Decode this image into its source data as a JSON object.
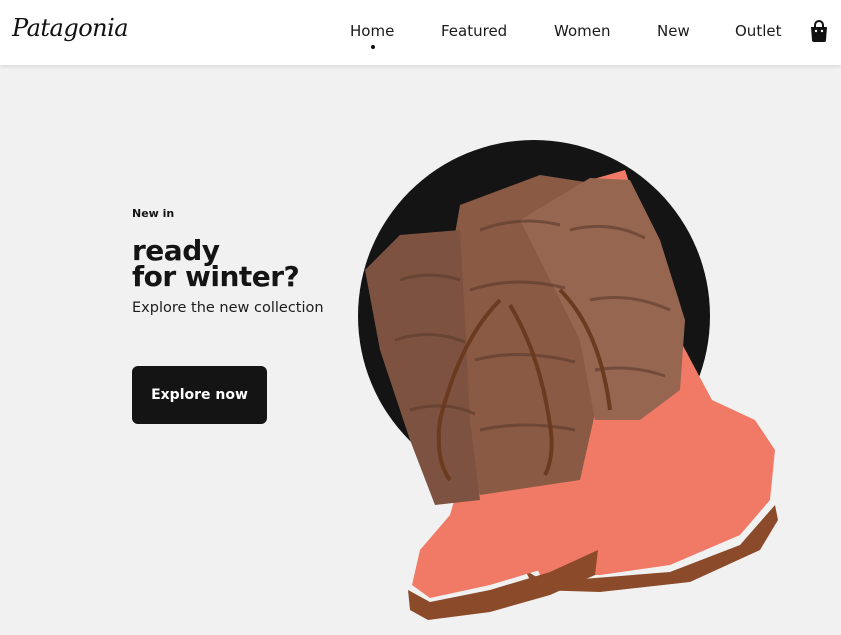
{
  "brand": {
    "name": "Patagonia"
  },
  "nav": {
    "items": [
      {
        "label": "Home",
        "active": true
      },
      {
        "label": "Featured"
      },
      {
        "label": "Women"
      },
      {
        "label": "New"
      },
      {
        "label": "Outlet"
      }
    ],
    "cart_icon": "shopping-bag-icon"
  },
  "hero": {
    "eyebrow": "New in",
    "headline_line1": "ready",
    "headline_line2": "for winter?",
    "subtitle": "Explore the new collection",
    "cta_label": "Explore now",
    "image": "fur-trimmed-boots"
  },
  "colors": {
    "background": "#f1f1f1",
    "header": "#ffffff",
    "dark": "#141414",
    "boot_coral": "#f07a66",
    "fur_brown": "#8a5a45",
    "sole_brown": "#8b4a2a"
  }
}
